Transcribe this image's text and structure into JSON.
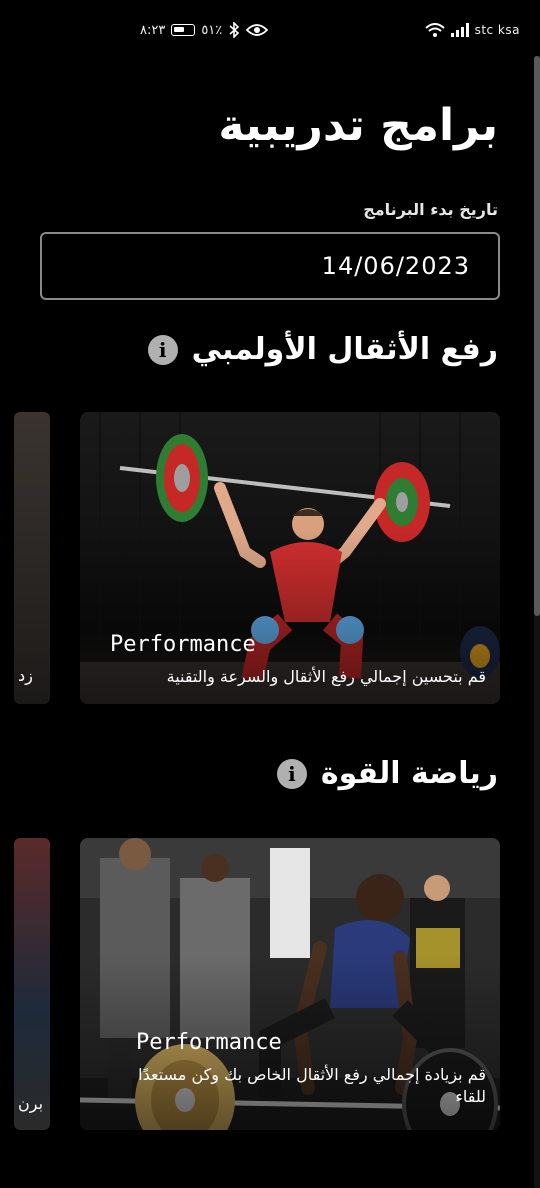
{
  "status_bar": {
    "time": "٨:٢٣",
    "battery": "٥١٪",
    "carrier": "stc ksa",
    "icons": [
      "battery-icon",
      "bluetooth-icon",
      "eye-icon",
      "wifi-icon",
      "signal-icon"
    ]
  },
  "page": {
    "title": "برامج تدريبية",
    "date_label": "تاريخ بدء البرنامج",
    "date_value": "14/06/2023"
  },
  "sections": [
    {
      "title": "رفع الأثقال الأولمبي",
      "info_icon": "info-icon",
      "card": {
        "tag": "Performance",
        "description": "قم بتحسين إجمالي رفع الأثقال والسرعة والتقنية"
      },
      "peek_text": "زد"
    },
    {
      "title": "رياضة القوة",
      "info_icon": "info-icon",
      "card": {
        "tag": "Performance",
        "description": "قم بزيادة إجمالي رفع الأثقال الخاص بك وكن مستعدًا للقاء"
      },
      "peek_text": "برن"
    }
  ],
  "colors": {
    "background": "#000000",
    "text": "#ffffff",
    "field_border": "#8a8a8a",
    "plate_red": "#c62828",
    "plate_green": "#2e7d32"
  }
}
